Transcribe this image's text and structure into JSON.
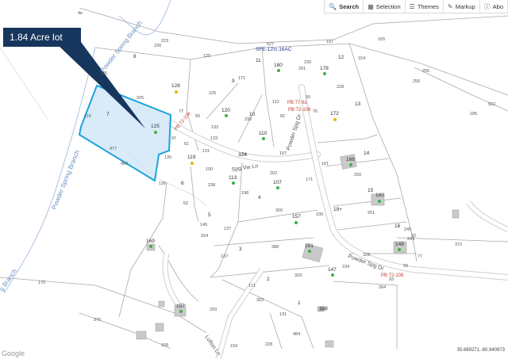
{
  "toolbar": {
    "items": [
      {
        "label": "Search",
        "icon": "search-icon"
      },
      {
        "label": "Selection",
        "icon": "selection-icon"
      },
      {
        "label": "Themes",
        "icon": "layers-icon"
      },
      {
        "label": "Markup",
        "icon": "pencil-icon"
      },
      {
        "label": "Abo",
        "icon": "info-icon"
      }
    ]
  },
  "callout": {
    "label": "1.84 Acre lot"
  },
  "status": {
    "coordinates": "35.689271,-80.940973"
  },
  "attribution": {
    "google": "Google"
  },
  "streams": {
    "upper": "Powder Spring Branch",
    "lower": "Powder Spring Branch",
    "bottom_left": "g Branch"
  },
  "roads": {
    "spg_vw_ln": "Spg Vw Ln",
    "powder_spg_dr_upper": "Powder Spg Dr",
    "powder_spg_dr_lower": "Powder Spg Dr",
    "lofton_ln": "Lofton Ln"
  },
  "plat_refs": {
    "sfe": "SFE-12\\n.16AC",
    "pb1": "PB 77-61",
    "pb2": "PB 72-108",
    "pb3": "PB 72-108",
    "pb4": "PB 72-108"
  },
  "parcel_ids": [
    "180",
    "178",
    "128",
    "120",
    "172",
    "110",
    "125",
    "119",
    "166",
    "113",
    "107",
    "160",
    "157",
    "151",
    "148",
    "147",
    "169",
    "157",
    "156",
    "174"
  ],
  "lot_numbers": [
    "8",
    "11",
    "12",
    "13",
    "14",
    "15",
    "16",
    "7",
    "6",
    "5",
    "4",
    "3",
    "2",
    "1",
    "9",
    "10",
    "19+"
  ],
  "dimensions": [
    "4e",
    "223",
    "230",
    "125",
    "627",
    "197",
    "165",
    "256",
    "255",
    "522",
    "185",
    "225",
    "171",
    "201",
    "230",
    "154",
    "228",
    "325",
    "77",
    "50",
    "112",
    "50",
    "76",
    "61",
    "97",
    "115",
    "133",
    "232",
    "82",
    "107",
    "174",
    "131",
    "133",
    "161",
    "250",
    "477",
    "483",
    "135",
    "100",
    "136",
    "238",
    "198",
    "202",
    "171",
    "251",
    "245",
    "52",
    "300",
    "100",
    "243",
    "92",
    "145",
    "137",
    "334",
    "388",
    "372",
    "137",
    "329",
    "234",
    "329",
    "93",
    "264",
    "170",
    "171",
    "303",
    "131",
    "376",
    "293",
    "168",
    "484",
    "228",
    "93",
    "256",
    "77",
    "159",
    "125"
  ]
}
